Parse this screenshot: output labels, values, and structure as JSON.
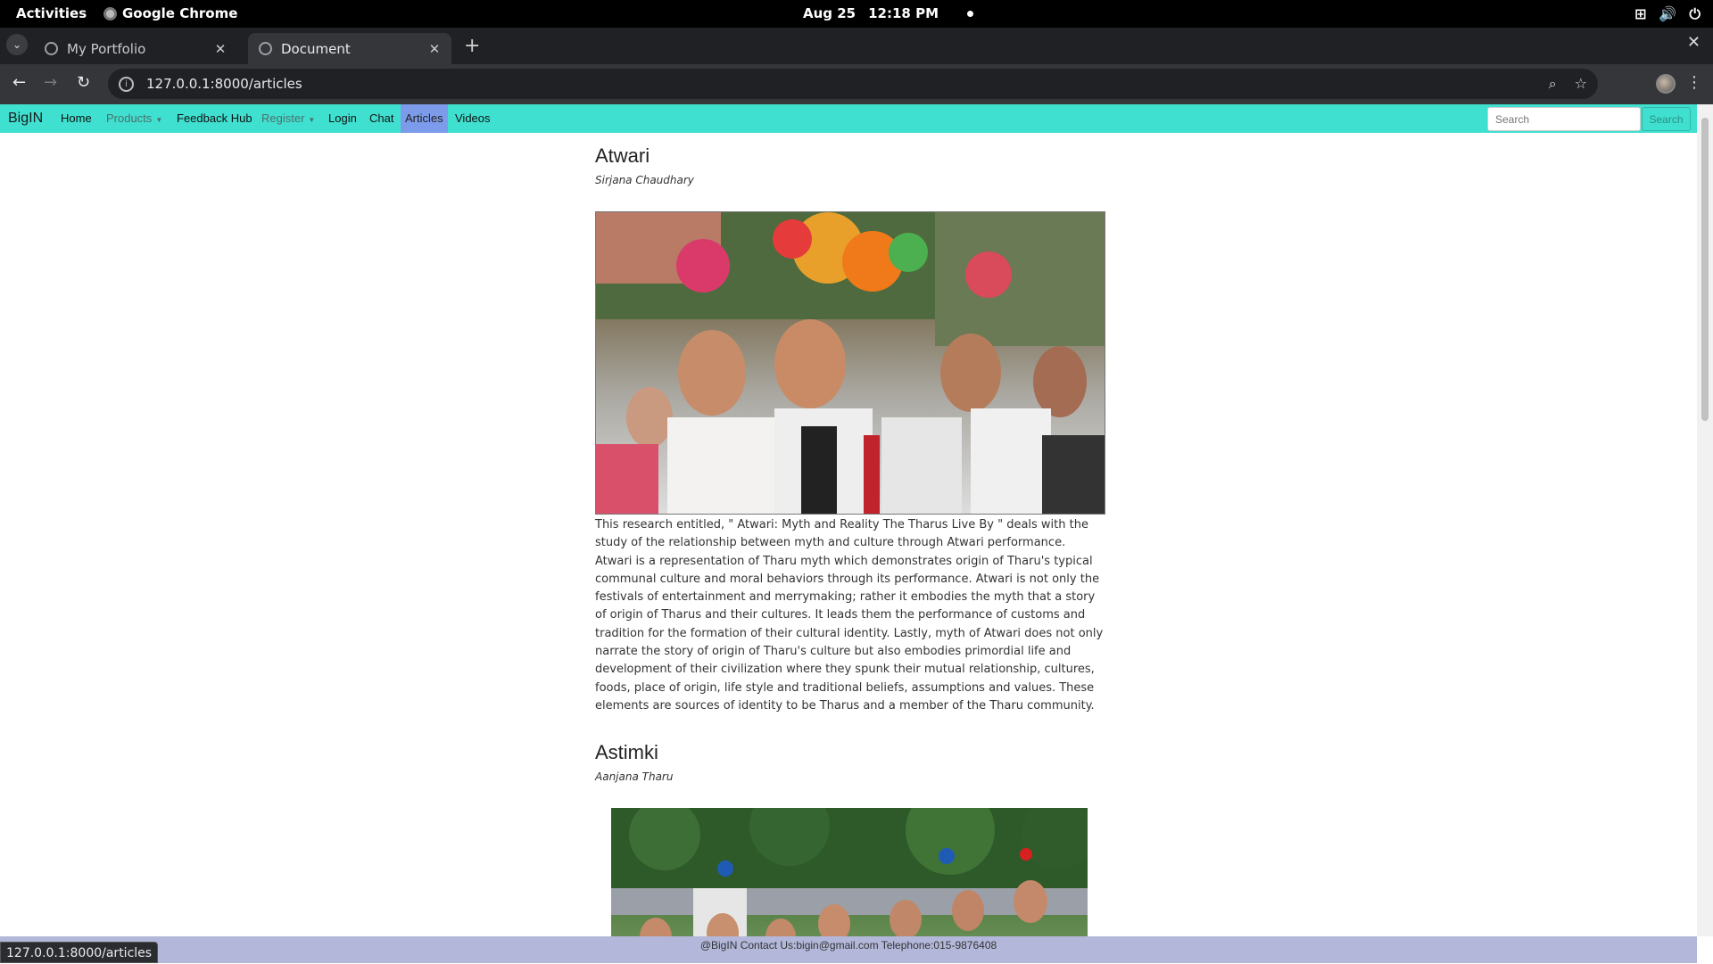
{
  "system_bar": {
    "activities": "Activities",
    "app_name": "Google Chrome",
    "date": "Aug 25",
    "time": "12:18 PM"
  },
  "browser": {
    "tabs": [
      {
        "title": "My Portfolio",
        "active": false
      },
      {
        "title": "Document",
        "active": true
      }
    ],
    "url": "127.0.0.1:8000/articles",
    "status_url": "127.0.0.1:8000/articles"
  },
  "site": {
    "brand": "BigIN",
    "nav": {
      "home": "Home",
      "products": "Products",
      "feedback": "Feedback Hub",
      "register": "Register",
      "login": "Login",
      "chat": "Chat",
      "articles": "Articles",
      "videos": "Videos"
    },
    "search": {
      "placeholder": "Search",
      "button": "Search"
    },
    "accent_color": "#40e0d0",
    "active_nav_color": "#7c9bea"
  },
  "articles": [
    {
      "title": "Atwari",
      "author": "Sirjana Chaudhary",
      "body": "This research entitled, \" Atwari: Myth and Reality The Tharus Live By \" deals with the study of the relationship between myth and culture through Atwari performance. Atwari is a representation of Tharu myth which demonstrates origin of Tharu's typical communal culture and moral behaviors through its performance. Atwari is not only the festivals of entertainment and merrymaking; rather it embodies the myth that a story of origin of Tharus and their cultures. It leads them the performance of customs and tradition for the formation of their cultural identity. Lastly, myth of Atwari does not only narrate the story of origin of Tharu's culture but also embodies primordial life and development of their civilization where they spunk their mutual relationship, cultures, foods, place of origin, life style and traditional beliefs, assumptions and values. These elements are sources of identity to be Tharus and a member of the Tharu community."
    },
    {
      "title": "Astimki",
      "author": "Aanjana Tharu"
    }
  ],
  "footer": "@BigIN Contact Us:bigin@gmail.com Telephone:015-9876408"
}
